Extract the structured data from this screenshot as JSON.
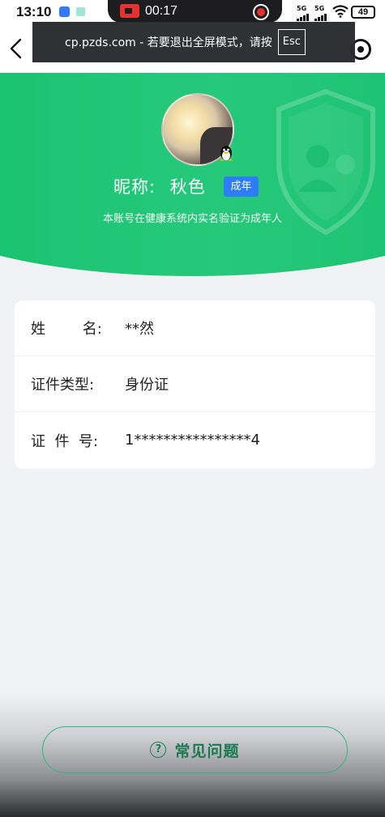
{
  "status_bar": {
    "time": "13:10",
    "recording_time": "00:17",
    "signal_1": "5G",
    "signal_2": "5G",
    "battery": "49"
  },
  "fullscreen_toast": {
    "message": "cp.pzds.com - 若要退出全屏模式，请按",
    "key": "Esc"
  },
  "profile": {
    "nickname_label": "昵称:",
    "nickname": "秋色",
    "badge": "成年",
    "verify_note": "本账号在健康系统内实名验证为成年人"
  },
  "info": {
    "rows": [
      {
        "label": "姓        名:",
        "value": "**然"
      },
      {
        "label": "证件类型:",
        "value": "身份证"
      },
      {
        "label": "证  件  号:",
        "value": "1****************4"
      }
    ]
  },
  "faq": {
    "label": "常见问题",
    "icon_text": "?"
  },
  "colors": {
    "brand_green": "#16c16d",
    "badge_blue": "#2e7cf6",
    "faq_green": "#1a7a4f"
  }
}
